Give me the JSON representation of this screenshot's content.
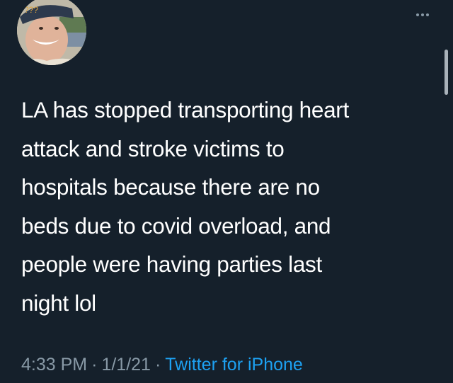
{
  "tweet": {
    "avatar_caption": "???",
    "text_lines": [
      "LA has stopped transporting heart",
      "attack and stroke victims to",
      "hospitals because there are no",
      "beds due to covid overload, and",
      "people were having parties last",
      "night lol"
    ],
    "time": "4:33 PM",
    "separator": "·",
    "date": "1/1/21",
    "source": "Twitter for iPhone"
  },
  "icons": {
    "more": "more-horizontal-icon"
  },
  "colors": {
    "background": "#15202b",
    "text": "#ffffff",
    "secondary_text": "#8899a6",
    "link": "#1da1f2"
  }
}
